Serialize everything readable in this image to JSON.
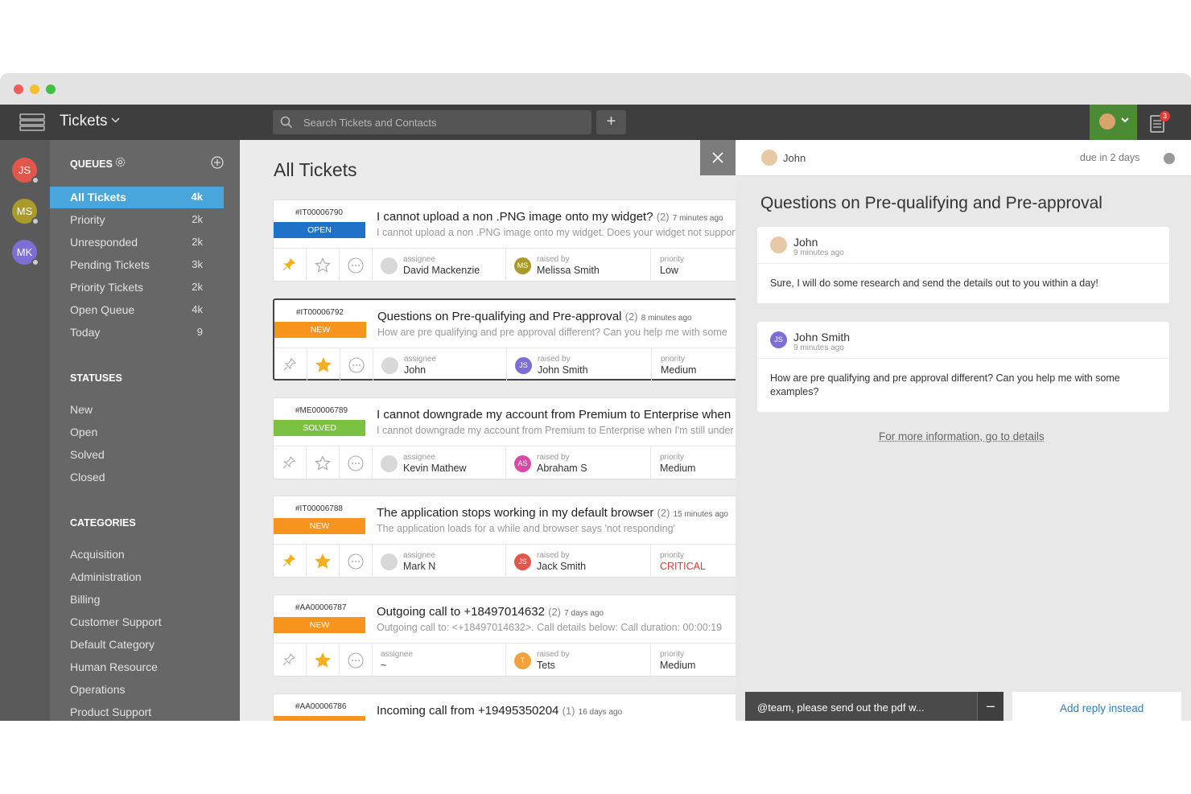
{
  "topbar": {
    "title": "Tickets",
    "search_placeholder": "Search Tickets and Contacts",
    "plus_label": "+",
    "notif_count": "3",
    "user_btn_color": "#4a8b34"
  },
  "rail": {
    "avatars": [
      {
        "initials": "JS",
        "color": "#e2574c"
      },
      {
        "initials": "MS",
        "color": "#a99a2a"
      },
      {
        "initials": "MK",
        "color": "#7b6fd6"
      }
    ]
  },
  "sidebar": {
    "queues_head": "QUEUES",
    "queues": [
      {
        "label": "All Tickets",
        "count": "4k"
      },
      {
        "label": "Priority",
        "count": "2k"
      },
      {
        "label": "Unresponded",
        "count": "2k"
      },
      {
        "label": "Pending Tickets",
        "count": "3k"
      },
      {
        "label": "Priority Tickets",
        "count": "2k"
      },
      {
        "label": "Open Queue",
        "count": "4k"
      },
      {
        "label": "Today",
        "count": "9"
      }
    ],
    "statuses_head": "STATUSES",
    "statuses": [
      "New",
      "Open",
      "Solved",
      "Closed"
    ],
    "categories_head": "CATEGORIES",
    "categories": [
      "Acquisition",
      "Administration",
      "Billing",
      "Customer Support",
      "Default Category",
      "Human Resource",
      "Operations",
      "Product Support"
    ],
    "active_color": "#49a6dd"
  },
  "main": {
    "title": "All Tickets",
    "labels": {
      "assignee": "assignee",
      "raised_by": "raised by",
      "priority": "priority"
    },
    "tickets": [
      {
        "id": "#IT00006790",
        "status": "OPEN",
        "status_color": "#1e73c9",
        "title": "I cannot upload a non .PNG image onto my widget?",
        "count": "(2)",
        "time": "7 minutes ago",
        "snippet": "I cannot upload a non .PNG image onto my widget. Does your widget not support",
        "assignee": "David Mackenzie",
        "raised_by": "Melissa Smith",
        "raised_initials": "MS",
        "raised_color": "#a99a2a",
        "priority": "Low",
        "pinned": true,
        "starred": false
      },
      {
        "id": "#IT00006792",
        "status": "NEW",
        "status_color": "#f7941d",
        "title": "Questions on Pre-qualifying and Pre-approval",
        "count": "(2)",
        "time": "8 minutes ago",
        "snippet": "How are pre qualifying and pre approval different? Can you help me with some",
        "assignee": "John",
        "raised_by": "John Smith",
        "raised_initials": "JS",
        "raised_color": "#7b6fd6",
        "priority": "Medium",
        "pinned": false,
        "starred": true
      },
      {
        "id": "#ME00006789",
        "status": "SOLVED",
        "status_color": "#7cc242",
        "title": "I cannot downgrade my account from Premium to Enterprise when",
        "count": "",
        "time": "",
        "snippet": "I cannot downgrade my account from Premium to Enterprise when I'm still under",
        "assignee": "Kevin Mathew",
        "raised_by": "Abraham S",
        "raised_initials": "AS",
        "raised_color": "#d94aa5",
        "priority": "Medium",
        "pinned": false,
        "starred": false
      },
      {
        "id": "#IT00006788",
        "status": "NEW",
        "status_color": "#f7941d",
        "title": "The application stops working in my default browser",
        "count": "(2)",
        "time": "15 minutes ago",
        "snippet": "The application loads for a while and browser says 'not responding'",
        "assignee": "Mark N",
        "raised_by": "Jack Smith",
        "raised_initials": "JS",
        "raised_color": "#e2574c",
        "priority": "CRITICAL",
        "priority_color": "#e53935",
        "pinned": true,
        "starred": true
      },
      {
        "id": "#AA00006787",
        "status": "NEW",
        "status_color": "#f7941d",
        "title": "Outgoing call to +18497014632",
        "count": "(2)",
        "time": "7 days ago",
        "snippet": "Outgoing call to: <+18497014632>. Call details below: Call duration: 00:00:19",
        "assignee": "~",
        "raised_by": "Tets",
        "raised_initials": "T",
        "raised_color": "#f0a33a",
        "priority": "Medium",
        "pinned": false,
        "starred": true
      },
      {
        "id": "#AA00006786",
        "status": "NEW",
        "status_color": "#f7941d",
        "title": "Incoming call from +19495350204",
        "count": "(1)",
        "time": "16 days ago",
        "snippet": "",
        "assignee": "",
        "raised_by": "",
        "raised_initials": "",
        "raised_color": "#f0a33a",
        "priority": "",
        "pinned": false,
        "starred": false
      }
    ]
  },
  "detail": {
    "header_name": "John",
    "due": "due in 2 days",
    "title": "Questions on Pre-qualifying and Pre-approval",
    "messages": [
      {
        "who": "John",
        "when": "9 minutes ago",
        "body": "Sure, I will do some research and send the details out to you within a day!"
      },
      {
        "who": "John Smith",
        "when": "9 minutes ago",
        "body": "How are pre qualifying and pre approval different? Can you help me with some examples?",
        "initials": "JS"
      }
    ],
    "more_link": "For more information, go to details",
    "reply_draft": "@team, please send out the pdf w...",
    "reply_minimize": "–",
    "reply_alt": "Add reply instead"
  }
}
